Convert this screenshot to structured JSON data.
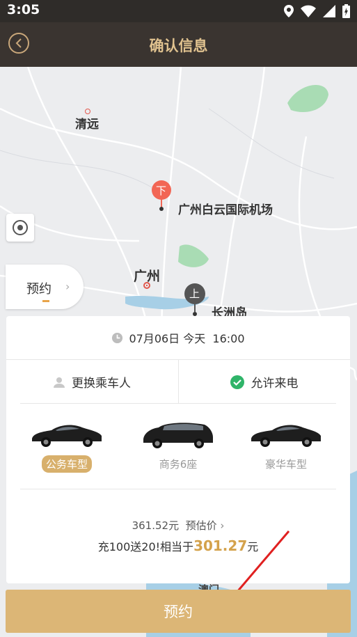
{
  "status_bar": {
    "time": "3:05"
  },
  "header": {
    "title": "确认信息"
  },
  "map": {
    "labels": {
      "qingyuan": "清远",
      "guangzhou": "广州",
      "airport": "广州白云国际机场",
      "changzhou": "长洲岛",
      "partial": "澳门"
    },
    "pins": {
      "dropoff": "下",
      "pickup": "上"
    }
  },
  "mode_pill": {
    "label": "预约"
  },
  "booking": {
    "datetime": "07月06日 今天  16:00",
    "change_passenger": "更换乘车人",
    "allow_call": "允许来电",
    "car_types": [
      {
        "label": "公务车型",
        "selected": true
      },
      {
        "label": "商务6座",
        "selected": false
      },
      {
        "label": "豪华车型",
        "selected": false
      }
    ],
    "price_text": "361.52元  预估价",
    "promo_prefix": "充100送20!相当于",
    "promo_amount": "301.27",
    "promo_suffix": "元"
  },
  "book_button": {
    "label": "预约"
  },
  "colors": {
    "accent": "#dcb676",
    "header_bg": "#3a3430",
    "title": "#e0c28f",
    "pin_red": "#f26655",
    "pin_dark": "#555555"
  }
}
